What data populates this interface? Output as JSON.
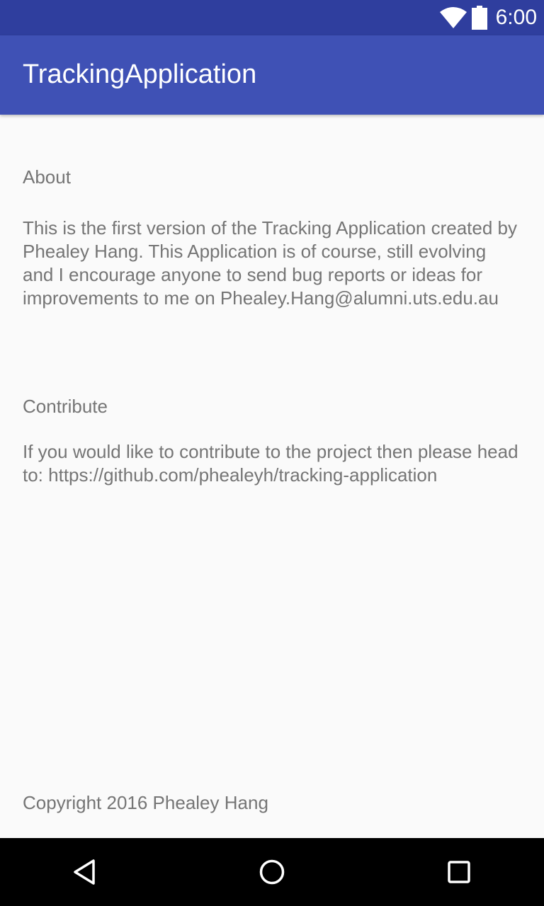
{
  "status_bar": {
    "time": "6:00",
    "icons": [
      "wifi-icon",
      "battery-icon"
    ]
  },
  "app_bar": {
    "title": "TrackingApplication",
    "color": "#3f51b5",
    "status_color": "#2f3e9e"
  },
  "about": {
    "heading": "About",
    "body": "This is the first version of the Tracking Application created by Phealey Hang. This Application is of course, still evolving and I encourage anyone to send bug reports or ideas for improvements to me on Phealey.Hang@alumni.uts.edu.au"
  },
  "contribute": {
    "heading": "Contribute",
    "body": "If you would like to contribute to the project then please head to: https://github.com/phealeyh/tracking-application"
  },
  "footer": {
    "copyright": "Copyright 2016 Phealey Hang"
  },
  "nav_bar": {
    "buttons": [
      "back-icon",
      "home-icon",
      "recents-icon"
    ]
  }
}
